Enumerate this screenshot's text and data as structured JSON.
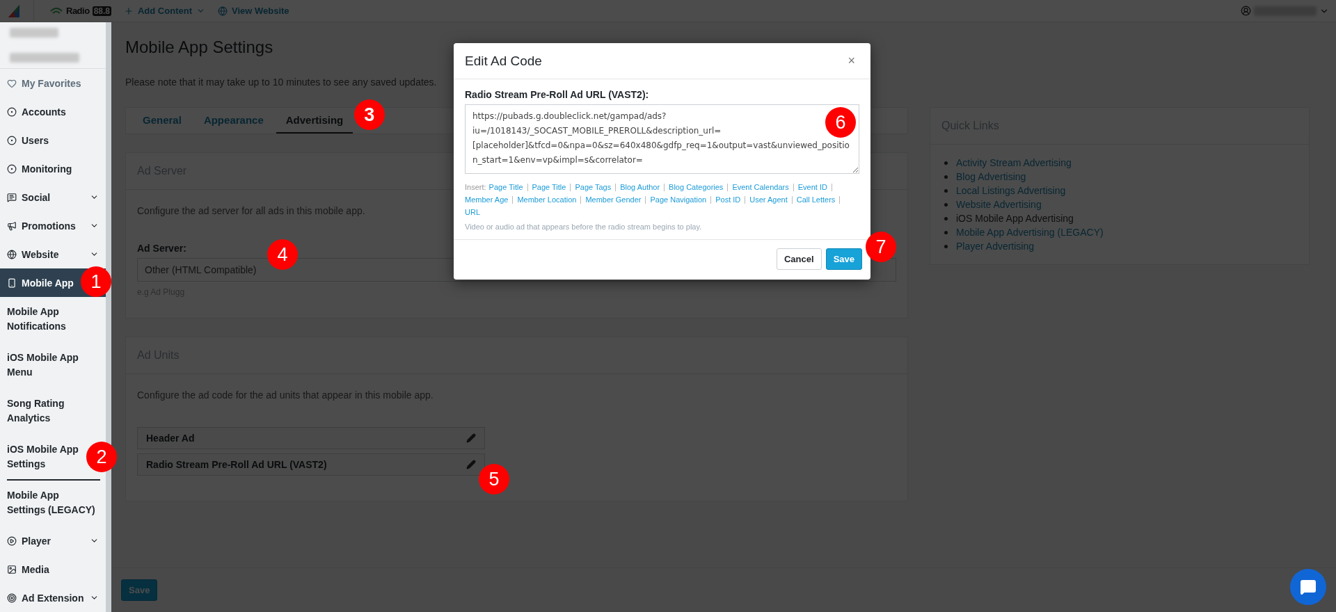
{
  "topbar": {
    "brand": "Radio",
    "brand_badge": "88.8",
    "add_content": "Add Content",
    "view_website": "View Website"
  },
  "sidebar": {
    "items": [
      {
        "label": "My Favorites",
        "kind": "favorite",
        "selected": false
      },
      {
        "label": "Accounts",
        "kind": "link",
        "selected": false
      },
      {
        "label": "Users",
        "kind": "link",
        "selected": false
      },
      {
        "label": "Monitoring",
        "kind": "link",
        "selected": false
      },
      {
        "label": "Social",
        "kind": "group",
        "selected": false,
        "expanded": false
      },
      {
        "label": "Promotions",
        "kind": "group",
        "selected": false,
        "expanded": false
      },
      {
        "label": "Website",
        "kind": "group",
        "selected": false,
        "expanded": false
      },
      {
        "label": "Mobile App",
        "kind": "group",
        "selected": true,
        "expanded": true,
        "callout": "1",
        "children": [
          {
            "label": "Mobile App Notifications",
            "selected": false
          },
          {
            "label": "iOS Mobile App Menu",
            "selected": false
          },
          {
            "label": "Song Rating Analytics",
            "selected": false
          },
          {
            "label": "iOS Mobile App Settings",
            "selected": true,
            "callout": "2"
          },
          {
            "label": "Mobile App Settings (LEGACY)",
            "selected": false
          }
        ]
      },
      {
        "label": "Player",
        "kind": "group",
        "selected": false,
        "expanded": false
      },
      {
        "label": "Media",
        "kind": "link",
        "selected": false
      },
      {
        "label": "Ad Extension",
        "kind": "group",
        "selected": false,
        "expanded": false
      }
    ]
  },
  "page": {
    "title": "Mobile App Settings",
    "note": "Please note that it may take up to 10 minutes to see any saved updates."
  },
  "tabs": [
    {
      "label": "General",
      "selected": false
    },
    {
      "label": "Appearance",
      "selected": false
    },
    {
      "label": "Advertising",
      "selected": true,
      "callout": "3"
    }
  ],
  "ad_server": {
    "title": "Ad Server",
    "description": "Configure the ad server for all ads in this mobile app.",
    "field_label": "Ad Server:",
    "value": "Other (HTML Compatible)",
    "help": "e.g Ad Plugg",
    "callout": "4"
  },
  "ad_units": {
    "title": "Ad Units",
    "description": "Configure the ad code for the ad units that appear in this mobile app.",
    "units": [
      "Header Ad",
      "Radio Stream Pre-Roll Ad URL (VAST2)"
    ],
    "callout": "5"
  },
  "quick_links": {
    "title": "Quick Links",
    "items": [
      {
        "label": "Activity Stream Advertising",
        "selected": false
      },
      {
        "label": "Blog Advertising",
        "selected": false
      },
      {
        "label": "Local Listings Advertising",
        "selected": false
      },
      {
        "label": "Website Advertising",
        "selected": false
      },
      {
        "label": "iOS Mobile App Advertising",
        "selected": true
      },
      {
        "label": "Mobile App Advertising (LEGACY)",
        "selected": false
      },
      {
        "label": "Player Advertising",
        "selected": false
      }
    ]
  },
  "footer": {
    "save": "Save"
  },
  "modal": {
    "title": "Edit Ad Code",
    "close": "×",
    "field_label": "Radio Stream Pre-Roll Ad URL (VAST2):",
    "value": "https://pubads.g.doubleclick.net/gampad/ads?iu=/1018143/_SOCAST_MOBILE_PREROLL&description_url=[placeholder]&tfcd=0&npa=0&sz=640x480&gdfp_req=1&output=vast&unviewed_position_start=1&env=vp&impl=s&correlator=",
    "field_callout": "6",
    "insert_label": "Insert:",
    "insert_links": [
      "Page Title",
      "Page Title",
      "Page Tags",
      "Blog Author",
      "Blog Categories",
      "Event Calendars",
      "Event ID",
      "Member Age",
      "Member Location",
      "Member Gender",
      "Page Navigation",
      "Post ID",
      "User Agent",
      "Call Letters",
      "URL"
    ],
    "help": "Video or audio ad that appears before the radio stream begins to play.",
    "cancel": "Cancel",
    "save": "Save",
    "save_callout": "7"
  }
}
